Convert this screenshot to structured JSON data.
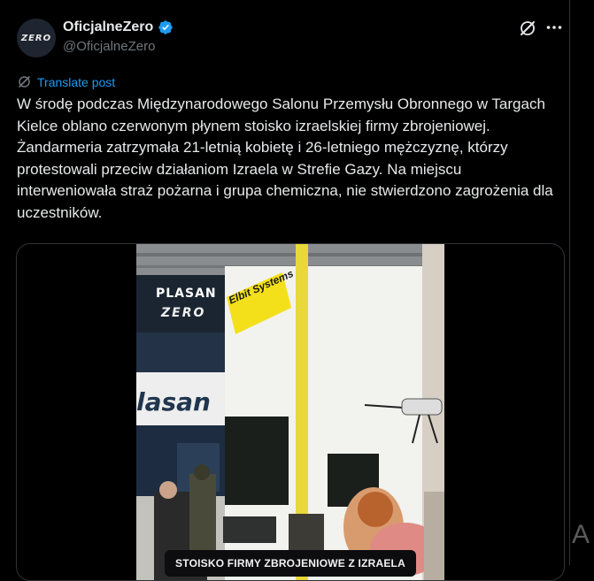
{
  "author": {
    "display_name": "OficjalneZero",
    "handle": "@OficjalneZero",
    "avatar_text": "ZERO",
    "verified": true
  },
  "actions": {
    "grok_icon": "grok-icon",
    "more_icon": "more-icon"
  },
  "translate": {
    "label": "Translate post",
    "icon": "translate-icon"
  },
  "post": {
    "text": "W środę podczas Międzynarodowego Salonu Przemysłu Obronnego w Targach Kielce oblano czerwonym płynem stoisko izraelskiej firmy zbrojeniowej. Żandarmeria zatrzymała 21-letnią kobietę i 26-letniego mężczyznę, którzy protestowali przeciw działaniom Izraela w Strefie Gazy. Na miejscu interweniowała straż pożarna i grupa chemiczna, nie stwierdzono zagrożenia dla uczestników."
  },
  "media": {
    "caption": "STOISKO FIRMY ZBROJENIOWE Z IZRAELA",
    "brand_plasan": "PLASAN",
    "brand_plasan_large": "lasan",
    "watermark": "ZERO",
    "brand_elbit": "Elbit Systems"
  },
  "corner_glyph": "A",
  "colors": {
    "accent": "#1d9bf0",
    "secondary_text": "#71767b",
    "border": "#2f3336"
  }
}
